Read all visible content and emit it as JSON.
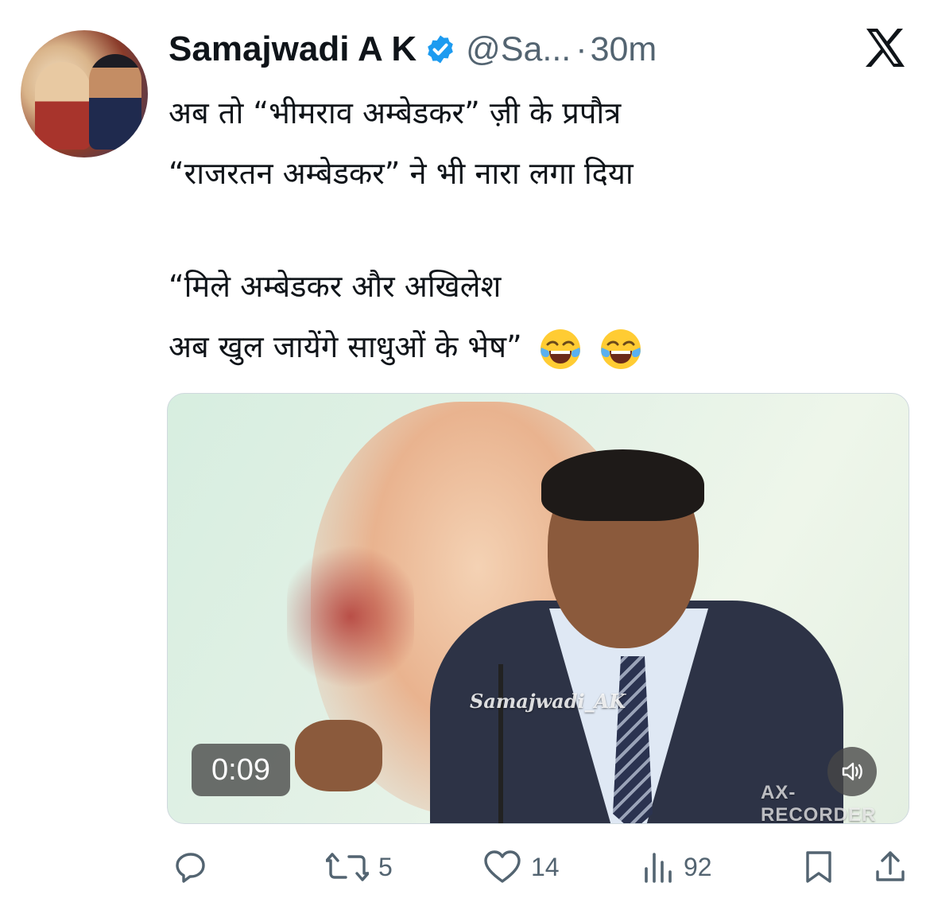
{
  "tweet": {
    "author_name": "Samajwadi A K",
    "handle": "@Sa...",
    "separator": "·",
    "time": "30m",
    "text_lines": [
      "अब तो “भीमराव अम्बेडकर” ज़ी के प्रपौत्र",
      "“राजरतन अम्बेडकर” ने भी नारा लगा दिया",
      "",
      "“मिले अम्बेडकर और अखिलेश",
      "अब खुल जायेंगे साधुओं के भेष”"
    ],
    "emojis": [
      "face-with-tears-of-joy",
      "face-with-tears-of-joy"
    ]
  },
  "media": {
    "watermark": "Samajwadi_AK",
    "duration": "0:09",
    "recorder_label": "AX-RECORDER"
  },
  "actions": {
    "reply_count": "",
    "retweet_count": "5",
    "like_count": "14",
    "views_count": "92"
  },
  "colors": {
    "text": "#0f1419",
    "secondary": "#536471",
    "verified_blue": "#1d9bf0"
  },
  "icons": [
    "verified-badge-icon",
    "x-logo-icon",
    "reply-icon",
    "retweet-icon",
    "like-icon",
    "views-icon",
    "bookmark-icon",
    "share-icon",
    "mute-icon"
  ]
}
